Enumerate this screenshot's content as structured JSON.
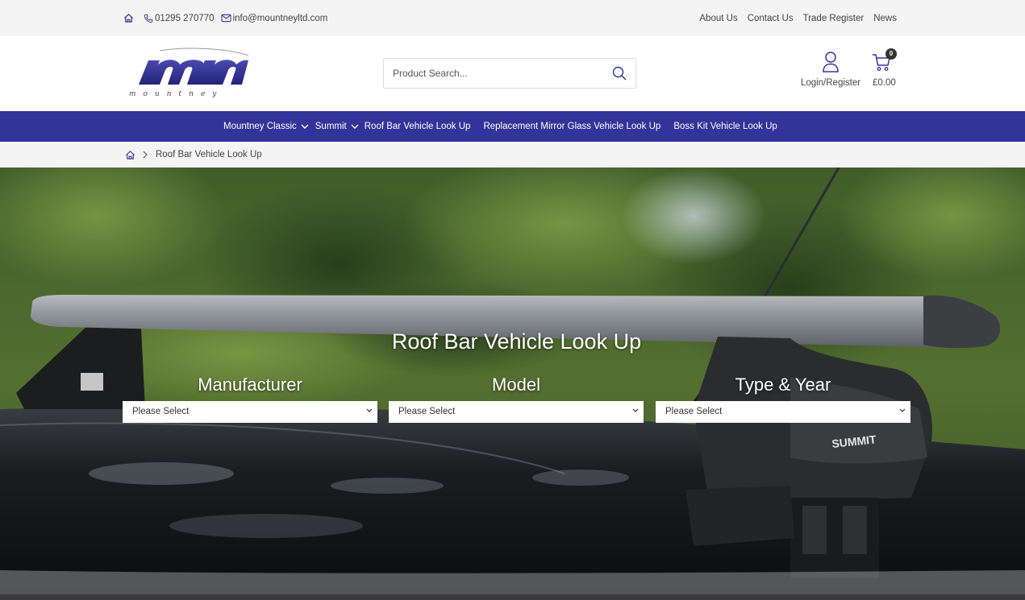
{
  "topbar": {
    "phone": "01295 270770",
    "email": "info@mountneyltd.com",
    "links": [
      "About Us",
      "Contact Us",
      "Trade Register",
      "News"
    ]
  },
  "header": {
    "logo_text": "mountney",
    "search": {
      "placeholder": "Product Search..."
    },
    "account_label": "Login/Register",
    "cart_count": "0",
    "cart_total": "£0.00"
  },
  "nav": {
    "items": [
      {
        "label": "Mountney Classic",
        "dropdown": true
      },
      {
        "label": "Summit",
        "dropdown": true
      },
      {
        "label": "Roof Bar Vehicle Look Up",
        "dropdown": false
      },
      {
        "label": "Replacement Mirror Glass Vehicle Look Up",
        "dropdown": false
      },
      {
        "label": "Boss Kit Vehicle Look Up",
        "dropdown": false
      }
    ]
  },
  "breadcrumb": {
    "current": "Roof Bar Vehicle Look Up"
  },
  "hero": {
    "title": "Roof Bar Vehicle Look Up",
    "fields": [
      {
        "label": "Manufacturer",
        "value": "Please Select"
      },
      {
        "label": "Model",
        "value": "Please Select"
      },
      {
        "label": "Type & Year",
        "value": "Please Select"
      }
    ],
    "brand_mark": "SUMMIT"
  },
  "colors": {
    "nav_bg": "#333399",
    "topbar_bg": "#f4f4f4",
    "logo_blue": "#2e2e8f"
  }
}
